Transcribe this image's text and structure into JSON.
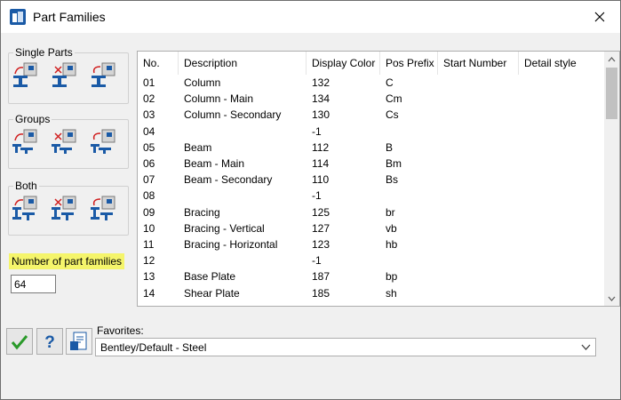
{
  "window": {
    "title": "Part Families"
  },
  "groups": {
    "single_parts": "Single Parts",
    "groups": "Groups",
    "both": "Both"
  },
  "families": {
    "count_label": "Number of part families",
    "count_value": "64"
  },
  "table": {
    "headers": [
      "No.",
      "Description",
      "Display Color",
      "Pos Prefix",
      "Start Number",
      "Detail style"
    ],
    "rows": [
      [
        "01",
        "Column",
        "132",
        "C"
      ],
      [
        "02",
        "Column - Main",
        "134",
        "Cm"
      ],
      [
        "03",
        "Column - Secondary",
        "130",
        "Cs"
      ],
      [
        "04",
        "",
        "-1",
        ""
      ],
      [
        "05",
        "Beam",
        "112",
        "B"
      ],
      [
        "06",
        "Beam - Main",
        "114",
        "Bm"
      ],
      [
        "07",
        "Beam - Secondary",
        "110",
        "Bs"
      ],
      [
        "08",
        "",
        "-1",
        ""
      ],
      [
        "09",
        "Bracing",
        "125",
        "br"
      ],
      [
        "10",
        "Bracing - Vertical",
        "127",
        "vb"
      ],
      [
        "11",
        "Bracing - Horizontal",
        "123",
        "hb"
      ],
      [
        "12",
        "",
        "-1",
        ""
      ],
      [
        "13",
        "Base Plate",
        "187",
        "bp"
      ],
      [
        "14",
        "Shear Plate",
        "185",
        "sh"
      ]
    ]
  },
  "favorites": {
    "label": "Favorites:",
    "value": "Bentley/Default - Steel"
  },
  "colors": {
    "highlight": "#f5f56b",
    "icon_blue": "#1a5aa6",
    "ok_green": "#2a9a2a"
  },
  "icons": {
    "app": "app-icon",
    "close": "close-icon",
    "ok": "checkmark-icon",
    "help": "question-icon",
    "export": "export-icon"
  }
}
